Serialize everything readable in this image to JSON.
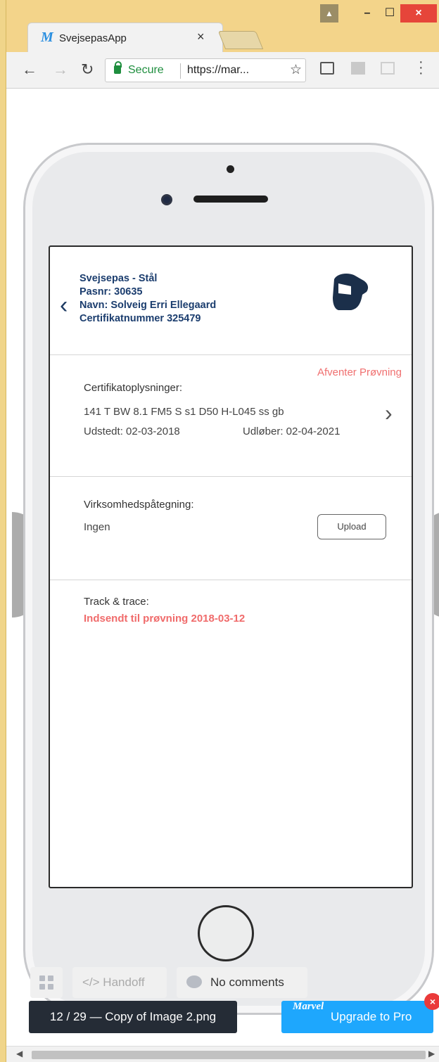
{
  "browser": {
    "tab_title": "SvejsepasApp",
    "tab_favicon": "M",
    "tab_close": "×",
    "secure_label": "Secure",
    "url": "https://mar...",
    "window_buttons": {
      "minimize": "–",
      "maximize": "☐",
      "close": "×"
    }
  },
  "app": {
    "header": {
      "line1": "Svejsepas - Stål",
      "line2": "Pasnr: 30635",
      "line3": "Navn: Solveig Erri Ellegaard",
      "line4": "Certifikatnummer 325479"
    },
    "status": "Afventer Prøvning",
    "certificate": {
      "label": "Certifikatoplysninger:",
      "code": "141 T BW 8.1 FM5 S s1 D50 H-L045 ss gb",
      "issued": "Udstedt: 02-03-2018",
      "expires": "Udløber: 02-04-2021"
    },
    "endorsement": {
      "label": "Virksomhedspåtegning:",
      "value": "Ingen",
      "upload_label": "Upload"
    },
    "tracking": {
      "label": "Track & trace:",
      "value": "Indsendt til prøvning 2018-03-12"
    }
  },
  "marvel": {
    "handoff_label": "</> Handoff",
    "comments_label": "No comments",
    "counter": "12 / 29 — Copy of Image 2.png",
    "upgrade_logo": "Marvel",
    "upgrade_label": "Upgrade to Pro",
    "close_badge": "×"
  },
  "colors": {
    "header_blue": "#1b3d6e",
    "status_red": "#f07070",
    "upgrade_blue": "#1ea7fd",
    "secure_green": "#1e8e3e"
  },
  "icons": [
    "back-arrow-icon",
    "forward-arrow-icon",
    "reload-icon",
    "lock-icon",
    "star-icon",
    "cast-icon",
    "menu-icon",
    "welding-helmet-icon",
    "chevron-left-icon",
    "chevron-right-icon",
    "grid-icon",
    "comment-icon"
  ]
}
